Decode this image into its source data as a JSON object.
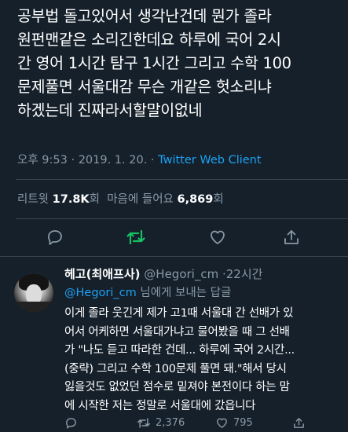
{
  "tweet": {
    "text": "공부법 돌고있어서 생각난건데 뭔가 졸라\n원펀맨같은 소리긴한데요 하루에 국어 2시\n간 영어 1시간 탐구 1시간 그리고 수학 100\n문제풀면 서울대감 무슨 개같은 헛소리냐\n하겠는데 진짜라서할말이없네",
    "time": "오후 9:53",
    "date": "2019. 1. 20.",
    "separator": "·",
    "client": "Twitter Web Client",
    "retweet_label": "리트윗",
    "retweet_count": "17.8K",
    "retweet_suffix": "회",
    "like_label": "마음에 들어요",
    "like_count": "6,869",
    "like_suffix": "회"
  },
  "actions": {
    "reply_icon": "reply-icon",
    "retweet_icon": "retweet-icon",
    "like_icon": "heart-icon",
    "share_icon": "share-icon",
    "retweet_color": "#17bf63",
    "icon_color": "#8899a6",
    "link_color": "#1da1f2"
  },
  "reply": {
    "name": "헤고(최애프사)",
    "handle": "@Hegori_cm",
    "separator": "·",
    "time": "22시간",
    "replying_to": "@Hegori_cm",
    "replying_suffix": "님에게 보내는 답글",
    "text": "이게 졸라 웃긴게 제가 고1때 서울대 간 선배가 있\n어서 어케하면 서울대가냐고 물어봤을 때 그 선배\n가 \"나도 듣고 따라한 건데... 하루에 국어 2시간...\n(중략) 그리고 수학 100문제 풀면 돼.\"해서 당시\n잃을것도 없었던 점수로 밑져야 본전이다 하는 맘\n에 시작한 저는 정말로 서울대에 갔읍니다",
    "retweet_count": "2,376",
    "like_count": "795"
  }
}
